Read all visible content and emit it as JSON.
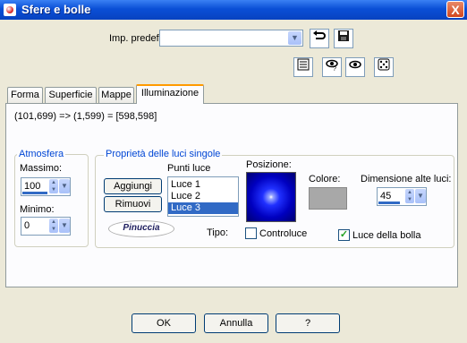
{
  "window": {
    "title": "Sfere e bolle",
    "close": "X"
  },
  "preset": {
    "label": "Imp. predef.:",
    "value": ""
  },
  "icons": {
    "preset_reset": "undo-arrow-icon",
    "preset_save": "floppy-disk-icon",
    "toolbar": [
      "options-list-icon",
      "eye-random-icon",
      "eye-icon",
      "dice-icon"
    ]
  },
  "tabs": [
    {
      "label": "Forma"
    },
    {
      "label": "Superficie"
    },
    {
      "label": "Mappe"
    },
    {
      "label": "Illuminazione"
    }
  ],
  "coords_text": "(101,699) => (1,599) = [598,598]",
  "atmosfera": {
    "title": "Atmosfera",
    "massimo_label": "Massimo:",
    "massimo_value": "100",
    "minimo_label": "Minimo:",
    "minimo_value": "0"
  },
  "lights": {
    "title": "Proprietà delle luci singole",
    "list_label": "Punti luce",
    "add_button": "Aggiungi",
    "remove_button": "Rimuovi",
    "items": [
      "Luce 1",
      "Luce 2",
      "Luce 3"
    ],
    "selected": "Luce 3",
    "logo_text": "Pinuccia",
    "position_label": "Posizione:",
    "color_label": "Colore:",
    "color_value": "#a8a8a8",
    "size_label": "Dimensione alte luci:",
    "size_value": "45",
    "type_label": "Tipo:",
    "backlight_label": "Controluce",
    "backlight_checked": false,
    "bubble_light_label": "Luce della bolla",
    "bubble_light_checked": true
  },
  "buttons": {
    "ok": "OK",
    "cancel": "Annulla",
    "help": "?"
  }
}
